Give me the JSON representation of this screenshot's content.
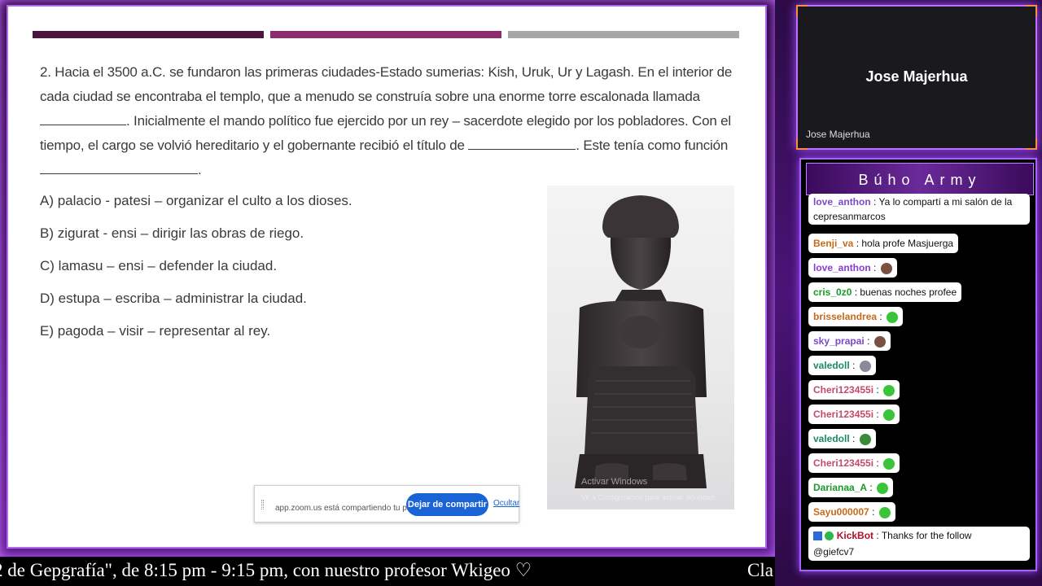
{
  "slide": {
    "question_parts": [
      "2. Hacia el 3500 a.C. se fundaron las primeras ciudades-Estado sumerias: Kish, Uruk, Ur y Lagash. En el interior de cada ciudad se encontraba el templo, que a menudo se construía sobre una enorme torre escalonada llamada",
      ". Inicialmente el mando político fue ejercido por un rey – sacerdote elegido por los pobladores. Con el tiempo, el cargo se volvió hereditario y el gobernante recibió el título de",
      ". Este tenía como función",
      "."
    ],
    "options": [
      "A) palacio - patesi – organizar el culto a los dioses.",
      "B) zigurat - ensi – dirigir las obras de riego.",
      "C) lamasu – ensi – defender la ciudad.",
      "D) estupa – escriba – administrar la ciudad.",
      "E) pagoda – visir – representar al rey."
    ],
    "watermark_line1": "Activar Windows",
    "watermark_line2": "Ve a Configuración para activar Windows."
  },
  "share_bar": {
    "message": "app.zoom.us está compartiendo tu pantalla.",
    "stop_label": "Dejar de compartir",
    "hide_label": "Ocultar"
  },
  "ticker": {
    "text": "2 de Gepgrafía\", de 8:15 pm - 9:15 pm, con nuestro profesor Wkigeo ♡",
    "text_right": "Cla"
  },
  "camera": {
    "name": "Jose Majerhua",
    "tag": "Jose Majerhua"
  },
  "chat": {
    "title": "Búho Army",
    "messages": [
      {
        "user": "love_anthon",
        "text": ": Ya lo compartí a mi salón de la",
        "text2": "cepresanmarcos",
        "emote": ""
      },
      {
        "user": "Benji_va",
        "text": ": hola profe Masjuerga",
        "emote": ""
      },
      {
        "user": "love_anthon",
        "text": ":",
        "emote": "brown"
      },
      {
        "user": "cris_0z0",
        "text": ": buenas noches profee",
        "emote": ""
      },
      {
        "user": "brisselandrea",
        "text": ":",
        "emote": "green"
      },
      {
        "user": "sky_prapai",
        "text": ":",
        "emote": "brown"
      },
      {
        "user": "valedoll",
        "text": ":",
        "emote": "gray"
      },
      {
        "user": "Cheri123455i",
        "text": ":",
        "emote": "green"
      },
      {
        "user": "Cheri123455i",
        "text": ":",
        "emote": "green"
      },
      {
        "user": "valedoll",
        "text": ":",
        "emote": "green"
      },
      {
        "user": "Cheri123455i",
        "text": ":",
        "emote": "green"
      },
      {
        "user": "Darianaa_A",
        "text": ":",
        "emote": "green"
      },
      {
        "user": "Sayu000007",
        "text": ":",
        "emote": "green"
      },
      {
        "user": "KickBot",
        "text": ": Thanks for the follow",
        "text2": "@giefcv7",
        "emote": ""
      }
    ]
  }
}
